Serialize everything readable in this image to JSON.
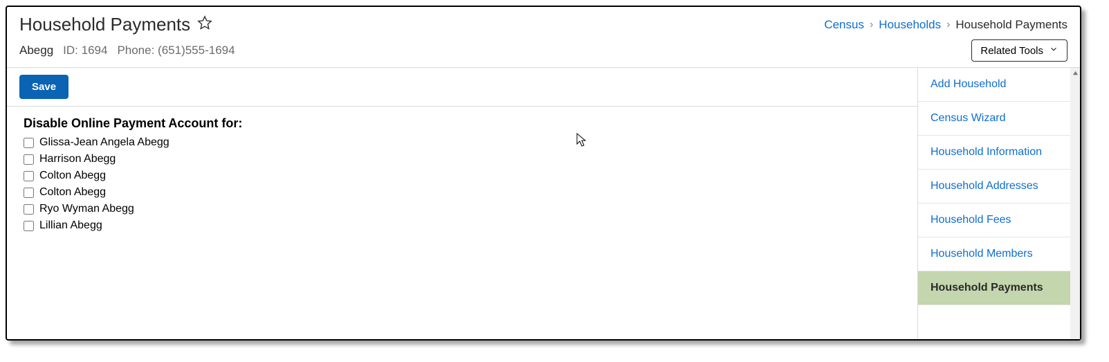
{
  "header": {
    "title": "Household Payments",
    "household_name": "Abegg",
    "id_label": "ID: 1694",
    "phone_label": "Phone: (651)555-1694",
    "related_tools_label": "Related Tools"
  },
  "breadcrumb": {
    "items": [
      {
        "label": "Census",
        "link": true
      },
      {
        "label": "Households",
        "link": true
      },
      {
        "label": "Household Payments",
        "link": false
      }
    ]
  },
  "toolbar": {
    "save_label": "Save"
  },
  "main": {
    "section_heading": "Disable Online Payment Account for:",
    "members": [
      {
        "name": "Glissa-Jean Angela Abegg",
        "checked": false
      },
      {
        "name": "Harrison Abegg",
        "checked": false
      },
      {
        "name": "Colton Abegg",
        "checked": false
      },
      {
        "name": "Colton Abegg",
        "checked": false
      },
      {
        "name": "Ryo Wyman Abegg",
        "checked": false
      },
      {
        "name": "Lillian Abegg",
        "checked": false
      }
    ]
  },
  "sidebar": {
    "items": [
      {
        "label": "Add Household",
        "active": false
      },
      {
        "label": "Census Wizard",
        "active": false
      },
      {
        "label": "Household Information",
        "active": false
      },
      {
        "label": "Household Addresses",
        "active": false
      },
      {
        "label": "Household Fees",
        "active": false
      },
      {
        "label": "Household Members",
        "active": false
      },
      {
        "label": "Household Payments",
        "active": true
      }
    ]
  }
}
